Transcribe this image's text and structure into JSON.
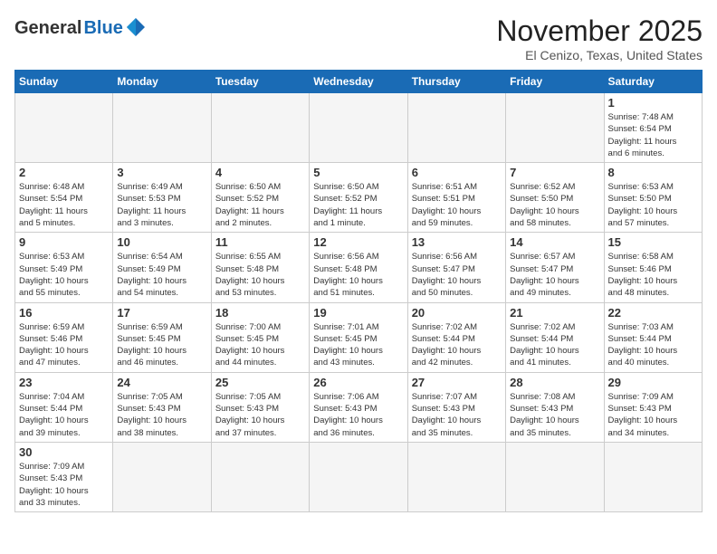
{
  "header": {
    "logo_general": "General",
    "logo_blue": "Blue",
    "month_title": "November 2025",
    "location": "El Cenizo, Texas, United States"
  },
  "days_of_week": [
    "Sunday",
    "Monday",
    "Tuesday",
    "Wednesday",
    "Thursday",
    "Friday",
    "Saturday"
  ],
  "weeks": [
    [
      {
        "day": "",
        "info": ""
      },
      {
        "day": "",
        "info": ""
      },
      {
        "day": "",
        "info": ""
      },
      {
        "day": "",
        "info": ""
      },
      {
        "day": "",
        "info": ""
      },
      {
        "day": "",
        "info": ""
      },
      {
        "day": "1",
        "info": "Sunrise: 7:48 AM\nSunset: 6:54 PM\nDaylight: 11 hours\nand 6 minutes."
      }
    ],
    [
      {
        "day": "2",
        "info": "Sunrise: 6:48 AM\nSunset: 5:54 PM\nDaylight: 11 hours\nand 5 minutes."
      },
      {
        "day": "3",
        "info": "Sunrise: 6:49 AM\nSunset: 5:53 PM\nDaylight: 11 hours\nand 3 minutes."
      },
      {
        "day": "4",
        "info": "Sunrise: 6:50 AM\nSunset: 5:52 PM\nDaylight: 11 hours\nand 2 minutes."
      },
      {
        "day": "5",
        "info": "Sunrise: 6:50 AM\nSunset: 5:52 PM\nDaylight: 11 hours\nand 1 minute."
      },
      {
        "day": "6",
        "info": "Sunrise: 6:51 AM\nSunset: 5:51 PM\nDaylight: 10 hours\nand 59 minutes."
      },
      {
        "day": "7",
        "info": "Sunrise: 6:52 AM\nSunset: 5:50 PM\nDaylight: 10 hours\nand 58 minutes."
      },
      {
        "day": "8",
        "info": "Sunrise: 6:53 AM\nSunset: 5:50 PM\nDaylight: 10 hours\nand 57 minutes."
      }
    ],
    [
      {
        "day": "9",
        "info": "Sunrise: 6:53 AM\nSunset: 5:49 PM\nDaylight: 10 hours\nand 55 minutes."
      },
      {
        "day": "10",
        "info": "Sunrise: 6:54 AM\nSunset: 5:49 PM\nDaylight: 10 hours\nand 54 minutes."
      },
      {
        "day": "11",
        "info": "Sunrise: 6:55 AM\nSunset: 5:48 PM\nDaylight: 10 hours\nand 53 minutes."
      },
      {
        "day": "12",
        "info": "Sunrise: 6:56 AM\nSunset: 5:48 PM\nDaylight: 10 hours\nand 51 minutes."
      },
      {
        "day": "13",
        "info": "Sunrise: 6:56 AM\nSunset: 5:47 PM\nDaylight: 10 hours\nand 50 minutes."
      },
      {
        "day": "14",
        "info": "Sunrise: 6:57 AM\nSunset: 5:47 PM\nDaylight: 10 hours\nand 49 minutes."
      },
      {
        "day": "15",
        "info": "Sunrise: 6:58 AM\nSunset: 5:46 PM\nDaylight: 10 hours\nand 48 minutes."
      }
    ],
    [
      {
        "day": "16",
        "info": "Sunrise: 6:59 AM\nSunset: 5:46 PM\nDaylight: 10 hours\nand 47 minutes."
      },
      {
        "day": "17",
        "info": "Sunrise: 6:59 AM\nSunset: 5:45 PM\nDaylight: 10 hours\nand 46 minutes."
      },
      {
        "day": "18",
        "info": "Sunrise: 7:00 AM\nSunset: 5:45 PM\nDaylight: 10 hours\nand 44 minutes."
      },
      {
        "day": "19",
        "info": "Sunrise: 7:01 AM\nSunset: 5:45 PM\nDaylight: 10 hours\nand 43 minutes."
      },
      {
        "day": "20",
        "info": "Sunrise: 7:02 AM\nSunset: 5:44 PM\nDaylight: 10 hours\nand 42 minutes."
      },
      {
        "day": "21",
        "info": "Sunrise: 7:02 AM\nSunset: 5:44 PM\nDaylight: 10 hours\nand 41 minutes."
      },
      {
        "day": "22",
        "info": "Sunrise: 7:03 AM\nSunset: 5:44 PM\nDaylight: 10 hours\nand 40 minutes."
      }
    ],
    [
      {
        "day": "23",
        "info": "Sunrise: 7:04 AM\nSunset: 5:44 PM\nDaylight: 10 hours\nand 39 minutes."
      },
      {
        "day": "24",
        "info": "Sunrise: 7:05 AM\nSunset: 5:43 PM\nDaylight: 10 hours\nand 38 minutes."
      },
      {
        "day": "25",
        "info": "Sunrise: 7:05 AM\nSunset: 5:43 PM\nDaylight: 10 hours\nand 37 minutes."
      },
      {
        "day": "26",
        "info": "Sunrise: 7:06 AM\nSunset: 5:43 PM\nDaylight: 10 hours\nand 36 minutes."
      },
      {
        "day": "27",
        "info": "Sunrise: 7:07 AM\nSunset: 5:43 PM\nDaylight: 10 hours\nand 35 minutes."
      },
      {
        "day": "28",
        "info": "Sunrise: 7:08 AM\nSunset: 5:43 PM\nDaylight: 10 hours\nand 35 minutes."
      },
      {
        "day": "29",
        "info": "Sunrise: 7:09 AM\nSunset: 5:43 PM\nDaylight: 10 hours\nand 34 minutes."
      }
    ],
    [
      {
        "day": "30",
        "info": "Sunrise: 7:09 AM\nSunset: 5:43 PM\nDaylight: 10 hours\nand 33 minutes."
      },
      {
        "day": "",
        "info": ""
      },
      {
        "day": "",
        "info": ""
      },
      {
        "day": "",
        "info": ""
      },
      {
        "day": "",
        "info": ""
      },
      {
        "day": "",
        "info": ""
      },
      {
        "day": "",
        "info": ""
      }
    ]
  ]
}
